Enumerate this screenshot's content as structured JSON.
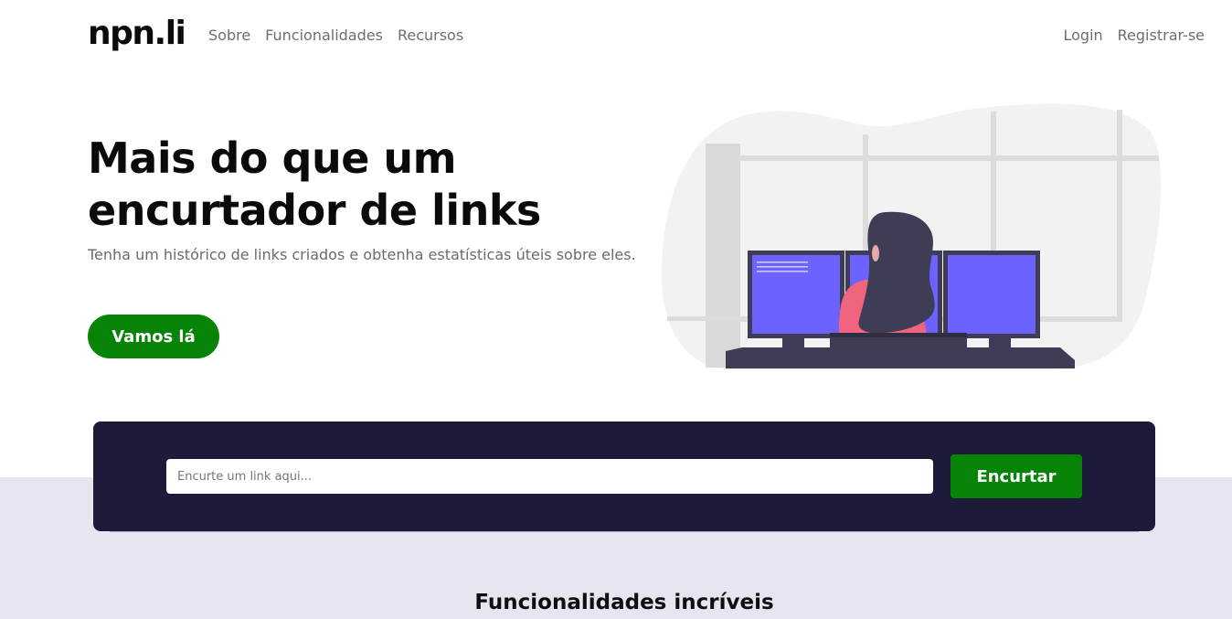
{
  "brand": {
    "logo": "npn.li"
  },
  "nav": {
    "links": [
      "Sobre",
      "Funcionalidades",
      "Recursos"
    ],
    "login": "Login",
    "register": "Registrar-se"
  },
  "hero": {
    "title_line1": "Mais do que um",
    "title_line2": "encurtador de links",
    "subtitle": "Tenha um histórico de links criados e obtenha estatísticas úteis sobre eles.",
    "cta_label": "Vamos lá",
    "illustration_icon": "woman-at-computers-illustration"
  },
  "shorten": {
    "placeholder": "Encurte um link aqui...",
    "value": "",
    "button_label": "Encurtar"
  },
  "features": {
    "title": "Funcionalidades incríveis"
  },
  "colors": {
    "primary_green": "#078307",
    "card_dark": "#1e1a3a",
    "section_bg": "#e6e5f1",
    "monitor_screen": "#6c63ff",
    "shirt": "#f06480"
  }
}
